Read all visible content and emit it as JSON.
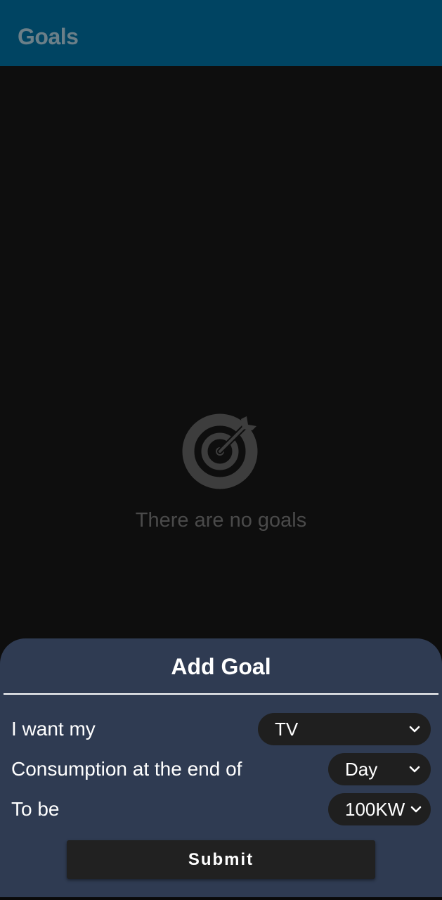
{
  "appbar": {
    "title": "Goals"
  },
  "empty_state": {
    "icon": "target-icon",
    "message": "There are no goals"
  },
  "add_goal_sheet": {
    "title": "Add Goal",
    "rows": [
      {
        "label": "I want my",
        "value": "TV"
      },
      {
        "label": "Consumption at the end of",
        "value": "Day"
      },
      {
        "label": "To be",
        "value": "100KW"
      }
    ],
    "submit_label": "Submit"
  },
  "colors": {
    "appbar": "#004462",
    "sheet": "#2f3b52",
    "background": "#0e0e0e",
    "control": "#1f1f1f"
  }
}
